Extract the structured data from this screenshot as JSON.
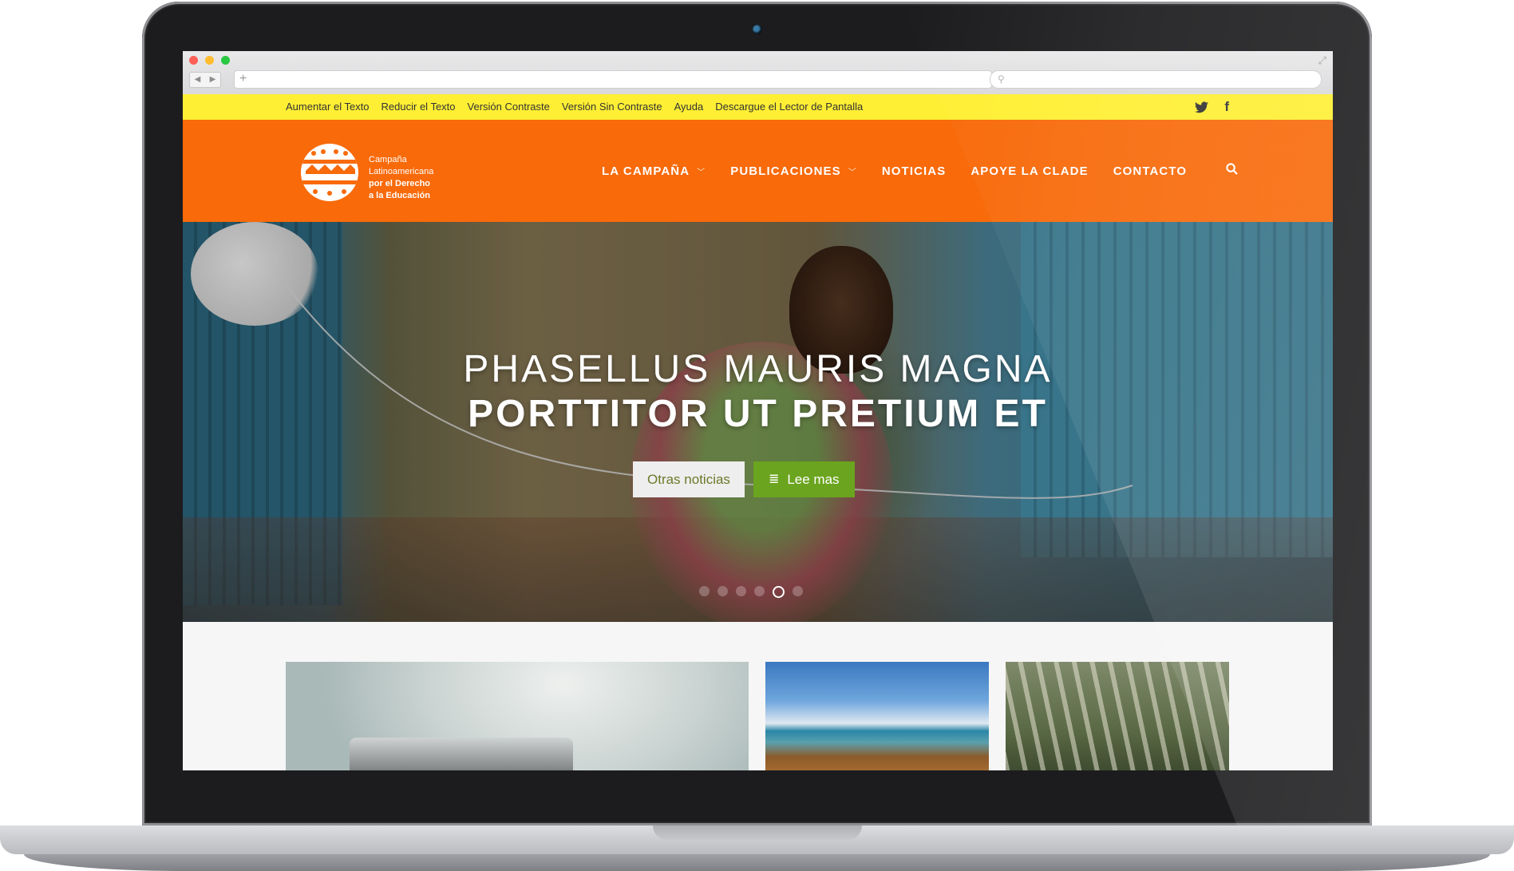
{
  "accessibility_bar": {
    "links": [
      "Aumentar el Texto",
      "Reducir el Texto",
      "Versión Contraste",
      "Versión Sin Contraste",
      "Ayuda",
      "Descargue el Lector de Pantalla"
    ],
    "social": {
      "twitter": "𝕐",
      "twitter_icon": "twitter-icon",
      "facebook": "f",
      "facebook_icon": "facebook-icon"
    }
  },
  "logo": {
    "line1": "Campaña",
    "line2": "Latinoamericana",
    "line3": "por el Derecho",
    "line4": "a la Educación"
  },
  "nav": {
    "items": [
      "LA CAMPAÑA",
      "PUBLICACIONES",
      "NOTICIAS",
      "APOYE LA CLADE",
      "CONTACTO"
    ],
    "dropdown_marker": "﹀",
    "search_icon": "⚲"
  },
  "hero": {
    "title_line1": "PHASELLUS MAURIS MAGNA",
    "title_line2": "PORTTITOR UT PRETIUM ET",
    "button_secondary": "Otras noticias",
    "button_primary": "Lee mas",
    "button_primary_icon": "≣",
    "slide_count": 6,
    "active_slide": 5
  },
  "browser": {
    "new_tab": "+",
    "back": "◀",
    "forward": "▶",
    "search_icon": "⚲",
    "expand": "⤢"
  },
  "colors": {
    "accent_orange": "#f86a0a",
    "accent_yellow": "#ffef34",
    "accent_green": "#6ba41e"
  }
}
